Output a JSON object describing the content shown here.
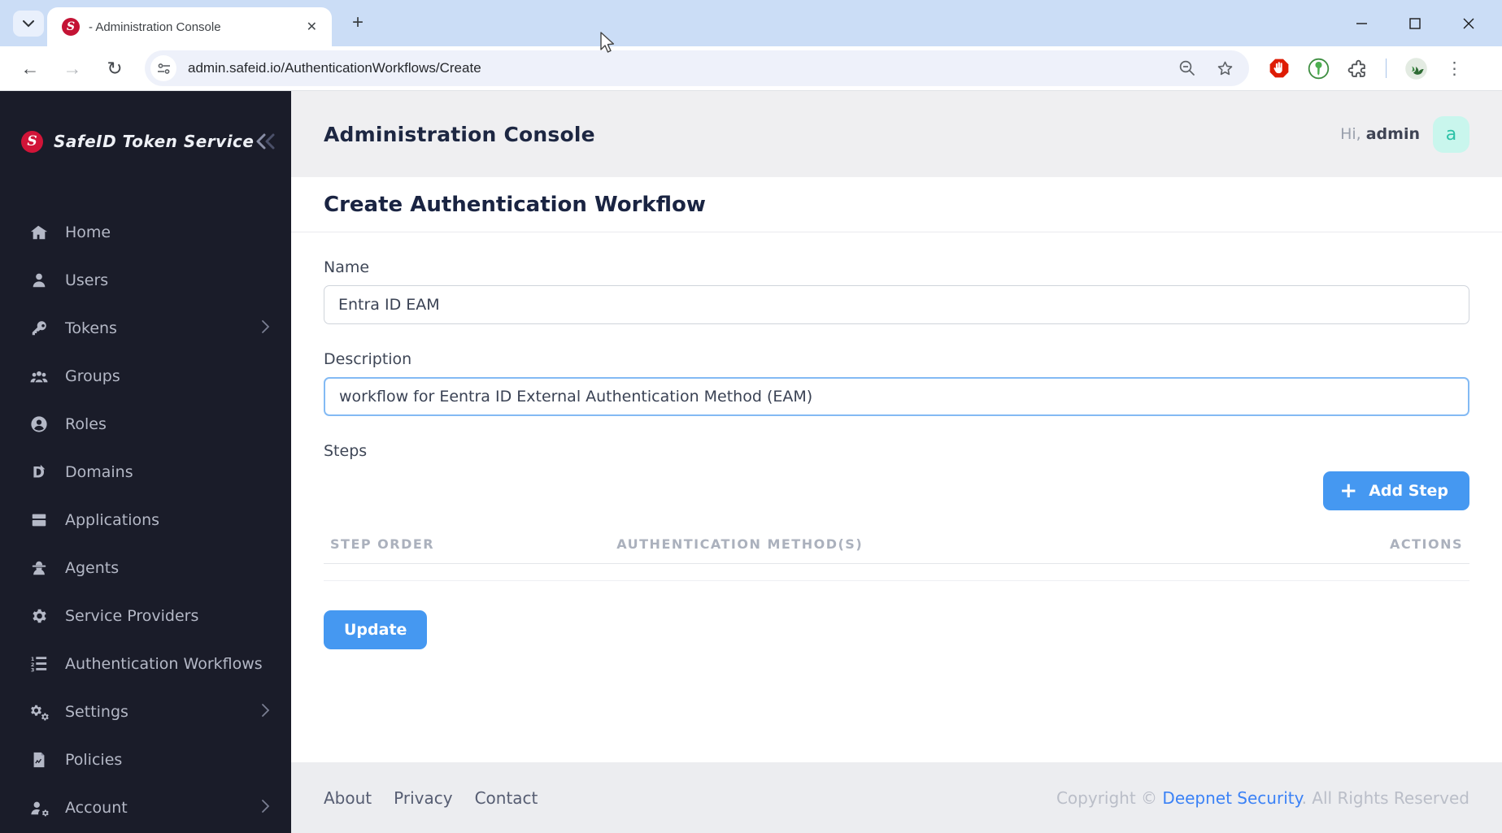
{
  "colors": {
    "accent": "#4598f1",
    "sidebar_bg": "#1a1c29",
    "sidebar_text": "#b4b8c6",
    "brand_red": "#d11438",
    "titlebar_bg": "#cbddf6",
    "topbar_bg": "#efeff1",
    "footer_bg": "#ecedf0",
    "header_text": "#1d2742",
    "avatar_bg": "#c9f6ed",
    "avatar_text": "#2cc2a7",
    "focus_border": "#83baf4",
    "link_blue": "#3b82f6",
    "muted": "#abb1bd",
    "stop_red": "#de1c05"
  },
  "browser": {
    "tab_title": "- Administration Console",
    "url": "admin.safeid.io/AuthenticationWorkflows/Create",
    "icons": {
      "back": "←",
      "forward": "→",
      "reload": "↻",
      "new_tab": "+",
      "tab_close": "✕",
      "menu": "⋮",
      "minimize": "–",
      "tab_search": "v"
    }
  },
  "sidebar": {
    "brand": "SafeID Token Service",
    "logo_letter": "S",
    "items": [
      {
        "label": "Home",
        "submenu": false
      },
      {
        "label": "Users",
        "submenu": false
      },
      {
        "label": "Tokens",
        "submenu": true
      },
      {
        "label": "Groups",
        "submenu": false
      },
      {
        "label": "Roles",
        "submenu": false
      },
      {
        "label": "Domains",
        "submenu": false
      },
      {
        "label": "Applications",
        "submenu": false
      },
      {
        "label": "Agents",
        "submenu": false
      },
      {
        "label": "Service Providers",
        "submenu": false
      },
      {
        "label": "Authentication Workflows",
        "submenu": false
      },
      {
        "label": "Settings",
        "submenu": true
      },
      {
        "label": "Policies",
        "submenu": false
      },
      {
        "label": "Account",
        "submenu": true
      }
    ]
  },
  "header": {
    "title": "Administration Console",
    "greeting_prefix": "Hi, ",
    "username": "admin",
    "avatar_letter": "a"
  },
  "page": {
    "title": "Create Authentication Workflow",
    "form": {
      "name_label": "Name",
      "name_value": "Entra ID EAM",
      "description_label": "Description",
      "description_value": "workflow for Eentra ID External Authentication Method (EAM)",
      "steps_label": "Steps",
      "add_step_label": "Add Step",
      "add_step_icon": "+",
      "update_label": "Update"
    },
    "table": {
      "headers": [
        "STEP ORDER",
        "AUTHENTICATION METHOD(S)",
        "ACTIONS"
      ],
      "rows": []
    }
  },
  "footer": {
    "links": [
      "About",
      "Privacy",
      "Contact"
    ],
    "copyright_prefix": "Copyright © ",
    "copyright_link": "Deepnet Security",
    "copyright_suffix": ". All Rights Reserved"
  }
}
